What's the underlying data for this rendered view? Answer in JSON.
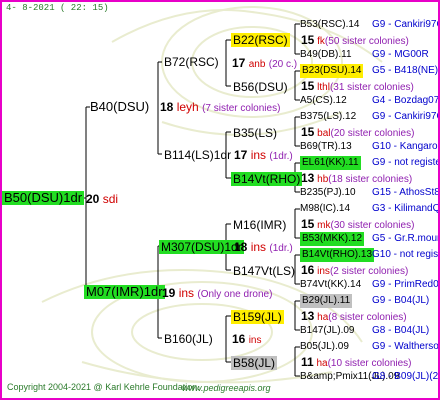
{
  "header": {
    "date": "4-  8-2021 ( 22: 15)"
  },
  "footer": {
    "copyright": "Copyright 2004-2021 @ Karl Kehrle Foundation.",
    "site": "www.pedigreeapis.org"
  },
  "colors": {
    "frame": "#e800c8",
    "green": "#22dd22",
    "yellow": "#ffee00",
    "gray": "#c0c0c0",
    "red": "#d00000",
    "purple": "#9020b0",
    "blue": "#0000cc"
  },
  "root": {
    "name": "B50(DSU)1dr",
    "num": "20",
    "tag": "sdi"
  },
  "gen1": [
    {
      "name": "B40(DSU)",
      "num": "18",
      "tag": "leyh",
      "note": "(7 sister colonies)"
    },
    {
      "name": "M07(IMR)1dr",
      "num": "19",
      "tag": "ins",
      "note": "(Only one drone)"
    }
  ],
  "gen2": [
    {
      "name": "B72(RSC)",
      "num": "17",
      "tag": "anb",
      "note": "(20 c.)"
    },
    {
      "name": "B114(LS)1dr",
      "num": "17",
      "tag": "ins",
      "note": "(1dr.)"
    },
    {
      "name": "M307(DSU)1dr",
      "num": "18",
      "tag": "ins",
      "note": "(1dr.)"
    },
    {
      "name": "B160(JL)",
      "num": "16",
      "tag": "ins",
      "note": ""
    }
  ],
  "gen3": [
    {
      "name": "B22(RSC)",
      "num": "15",
      "tag": ""
    },
    {
      "name": "B56(DSU)",
      "num": "",
      "tag": ""
    },
    {
      "name": "B35(LS)",
      "num": "",
      "tag": ""
    },
    {
      "name": "B14Vt(RHO)",
      "num": "",
      "tag": ""
    },
    {
      "name": "M16(IMR)",
      "num": "",
      "tag": ""
    },
    {
      "name": "B147Vt(LS)",
      "num": "",
      "tag": ""
    },
    {
      "name": "B159(JL)",
      "num": "",
      "tag": ""
    },
    {
      "name": "B58(JL)",
      "num": "",
      "tag": ""
    }
  ],
  "gen4": [
    {
      "a": "B53(RSC).14",
      "b": "G9 - Cankiri97Q",
      "num": "15",
      "tag": "fk",
      "note": "(50 sister colonies)",
      "c": "B49(DB).11",
      "d": "G9 - MG00R"
    },
    {
      "a": "B23(DSU).14",
      "b": "G5 - B418(NE)",
      "num": "15",
      "tag": "lthl",
      "note": "(31 sister colonies)",
      "c": "A5(CS).12",
      "d": "G4 - Bozdag07R"
    },
    {
      "a": "B375(LS).12",
      "b": "G9 - Cankiri97Q",
      "num": "15",
      "tag": "bal",
      "note": "(20 sister colonies)",
      "c": "B69(TR).13",
      "d": "G10 - Kangaroo98R"
    },
    {
      "a": "EL61(KK).11",
      "b": "G9 - not registe",
      "num": "13",
      "tag": "hb",
      "note": "(18 sister colonies)",
      "c": "B235(PJ).10",
      "d": "G15 - AthosSt80R"
    },
    {
      "a": "M98(IC).14",
      "b": "G3 - KilimandQ",
      "num": "15",
      "tag": "mk",
      "note": "(30 sister colonies)",
      "c": "B53(MKK).12",
      "d": "G5 - Gr.R.mounta"
    },
    {
      "a": "B14Vt(RHO).13",
      "b": "G10 - not registe",
      "num": "16",
      "tag": "ins",
      "note": "(2 sister colonies)",
      "c": "B74Vt(KK).14",
      "d": "G9 - PrimRed01"
    },
    {
      "a": "B29(JL).11",
      "b": "G9 - B04(JL)",
      "num": "13",
      "tag": "ha",
      "note": "(8 sister colonies)",
      "c": "B147(JL).09",
      "d": "G8 - B04(JL)"
    },
    {
      "a": "B05(JL).09",
      "b": "G9 - Waltherson",
      "num": "11",
      "tag": "ha",
      "note": "(10 sister colonies)",
      "c": "B&amp;Pmix11(JL).09",
      "d": "G8 - B09(JL)(2x)"
    }
  ],
  "gen3_extra": {
    "b22_num": "17",
    "b22_tag": "anb",
    "b22_note": "(20 c.)",
    "b159_num": "16",
    "b159_tag": "ins"
  }
}
